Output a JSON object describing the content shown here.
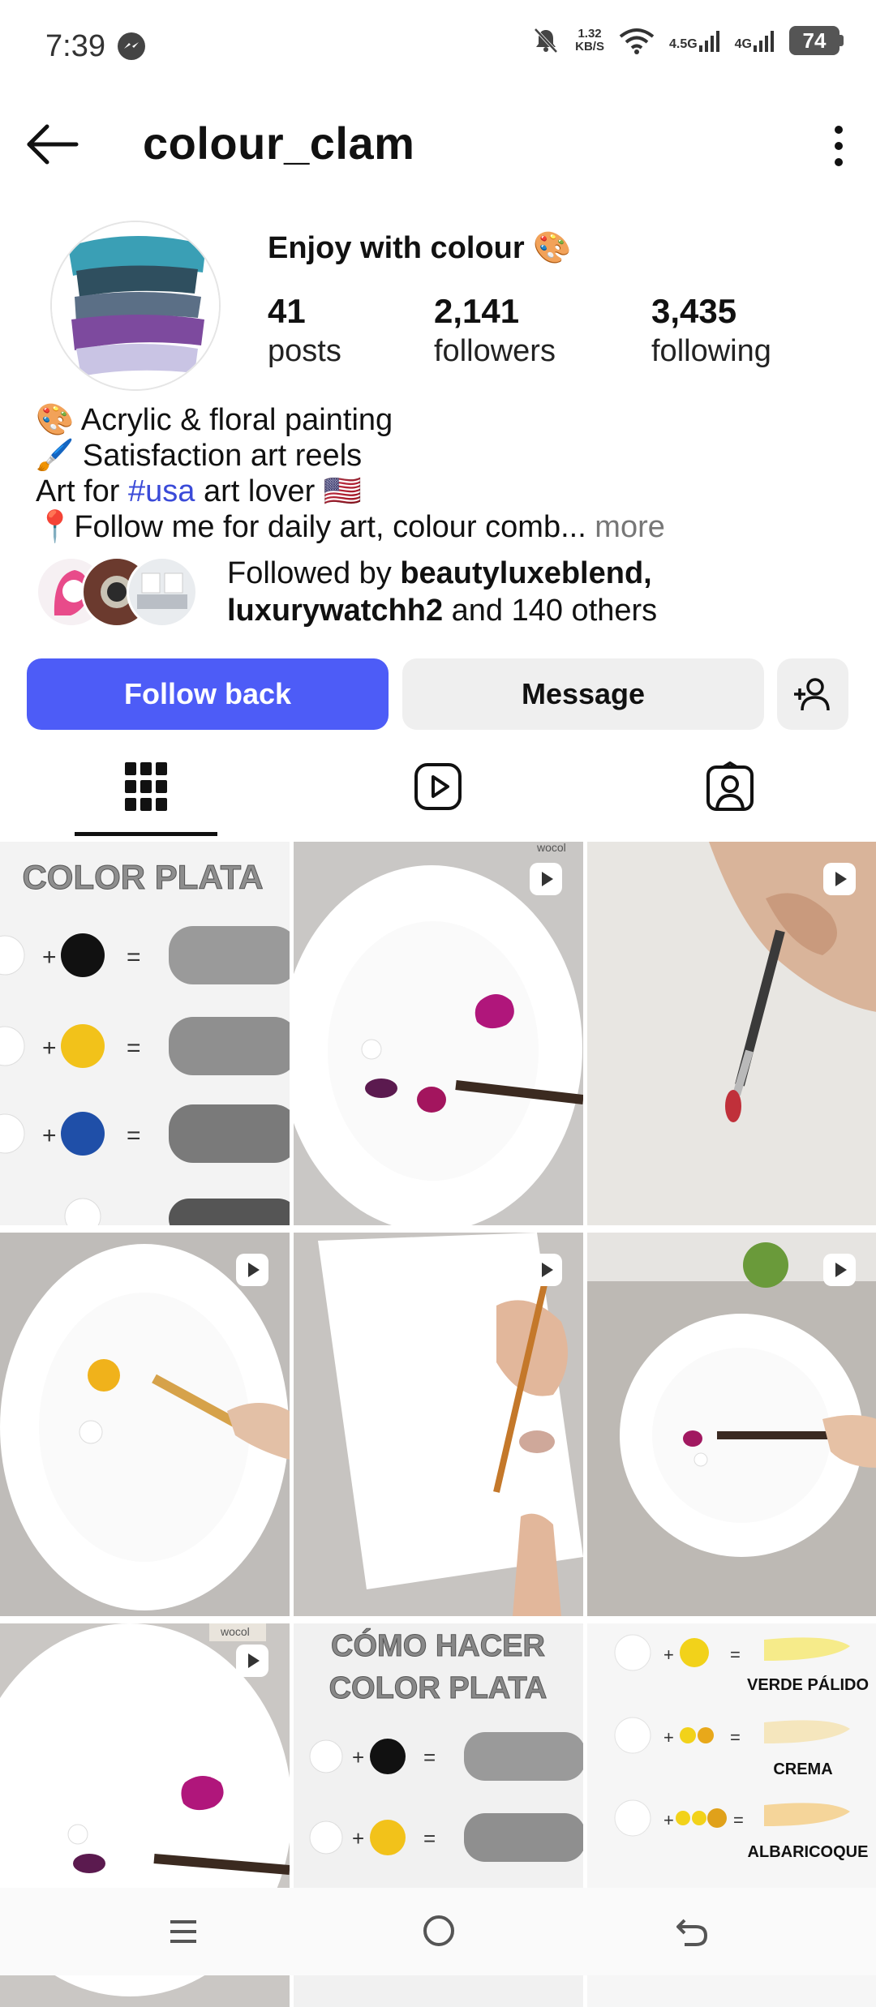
{
  "status_bar": {
    "time": "7:39",
    "net_speed_value": "1.32",
    "net_speed_unit": "KB/S",
    "signal1_label": "4.5G",
    "signal2_label": "4G",
    "battery": "74"
  },
  "header": {
    "username": "colour_clam"
  },
  "profile": {
    "name": "Enjoy with colour 🎨",
    "stats": [
      {
        "value": "41",
        "label": "posts"
      },
      {
        "value": "2,141",
        "label": "followers"
      },
      {
        "value": "3,435",
        "label": "following"
      }
    ],
    "bio": {
      "line1": "🎨 Acrylic & floral painting",
      "line2": "🖌️ Satisfaction art reels",
      "line3_pre": "Art for ",
      "line3_hashtag": "#usa",
      "line3_post": " art lover 🇺🇸",
      "line4": "📍Follow me for daily art, colour comb...",
      "line4_more": " more"
    },
    "followed_by": {
      "prefix": "Followed by ",
      "user1": "beautyluxeblend,",
      "user2": "luxurywatchh2",
      "suffix": " and 140 others"
    }
  },
  "actions": {
    "follow_back": "Follow back",
    "message": "Message"
  },
  "grid": {
    "cell1_title": "COLOR PLATA",
    "cell2_watermark": "wocol",
    "cell7_watermark": "wocol",
    "cell8_line1": "CÓMO HACER",
    "cell8_line2": "COLOR PLATA",
    "cell9_label1": "VERDE PÁLIDO",
    "cell9_label2": "CREMA",
    "cell9_label3": "ALBARICOQUE"
  },
  "colors": {
    "accent": "#4d5cf7",
    "hashtag": "#3a4ad8",
    "secondary_button": "#efefef"
  }
}
